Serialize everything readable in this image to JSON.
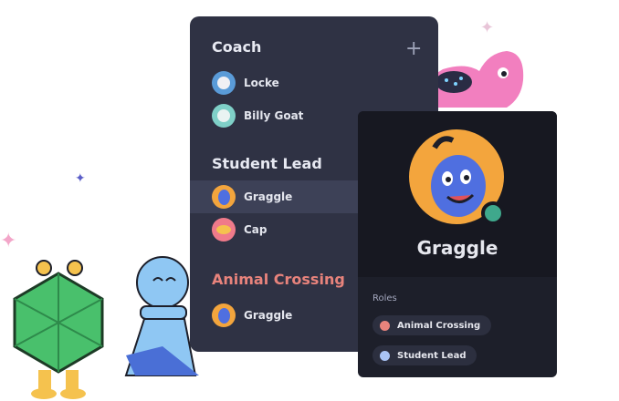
{
  "sidebar": {
    "groups": [
      {
        "title": "Coach",
        "members": [
          {
            "name": "Locke"
          },
          {
            "name": "Billy Goat"
          }
        ]
      },
      {
        "title": "Student Lead",
        "members": [
          {
            "name": "Graggle"
          },
          {
            "name": "Cap"
          }
        ]
      },
      {
        "title": "Animal Crossing",
        "members": [
          {
            "name": "Graggle"
          }
        ]
      }
    ],
    "add_icon": "+"
  },
  "profile": {
    "name": "Graggle",
    "roles_label": "Roles",
    "roles": [
      {
        "name": "Animal Crossing",
        "color": "#e8837c"
      },
      {
        "name": "Student Lead",
        "color": "#a9c4f5"
      }
    ],
    "status_color": "#3fa88c"
  },
  "colors": {
    "panel": "#2f3244",
    "animal_crossing_heading": "#e8837c"
  }
}
